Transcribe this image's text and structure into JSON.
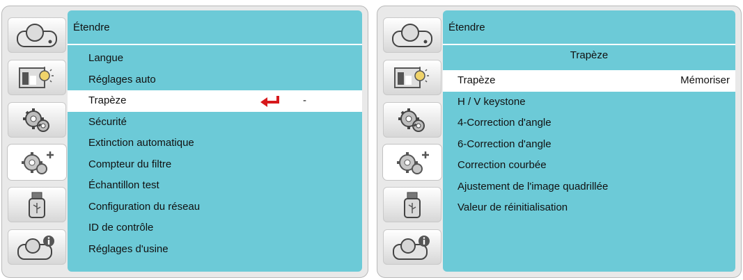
{
  "left": {
    "title": "Étendre",
    "items": [
      {
        "label": "Langue"
      },
      {
        "label": "Réglages auto"
      },
      {
        "label": "Trapèze",
        "value": "-"
      },
      {
        "label": "Sécurité"
      },
      {
        "label": "Extinction automatique"
      },
      {
        "label": "Compteur du filtre"
      },
      {
        "label": "Échantillon test"
      },
      {
        "label": "Configuration du réseau"
      },
      {
        "label": "ID de contrôle"
      },
      {
        "label": "Réglages d'usine"
      }
    ]
  },
  "right": {
    "title": "Étendre",
    "subtitle": "Trapèze",
    "items": [
      {
        "label": "Trapèze",
        "value": "Mémoriser"
      },
      {
        "label": "H / V keystone"
      },
      {
        "label": "4-Correction d'angle"
      },
      {
        "label": "6-Correction d'angle"
      },
      {
        "label": "Correction courbée"
      },
      {
        "label": "Ajustement de l'image quadrillée"
      },
      {
        "label": "Valeur de réinitialisation"
      }
    ]
  },
  "sidebar_icons": [
    "projector-icon",
    "image-adjust-icon",
    "settings-icon",
    "extended-settings-icon",
    "usb-icon",
    "information-icon"
  ],
  "colors": {
    "menu": "#6ccad7",
    "highlight": "#ffffff",
    "accent": "#d7191c"
  }
}
